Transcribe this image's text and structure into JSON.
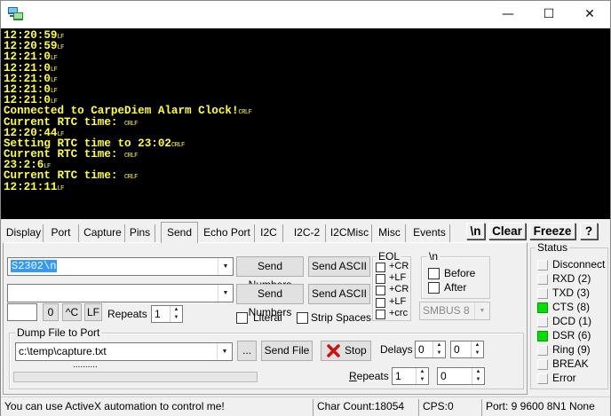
{
  "window": {
    "minimize": "—",
    "maximize": "☐",
    "close": "✕"
  },
  "terminal": {
    "lines": [
      {
        "text": "12:20:59",
        "ctrl": "LF"
      },
      {
        "text": "12:20:59",
        "ctrl": "LF"
      },
      {
        "text": "12:21:0",
        "ctrl": "LF"
      },
      {
        "text": "12:21:0",
        "ctrl": "LF"
      },
      {
        "text": "12:21:0",
        "ctrl": "LF"
      },
      {
        "text": "12:21:0",
        "ctrl": "LF"
      },
      {
        "text": "12:21:0",
        "ctrl": "LF"
      },
      {
        "text": "Connected to CarpeDiem Alarm Clock!",
        "ctrl": "CRLF"
      },
      {
        "text": "Current RTC time: ",
        "ctrl": "CRLF"
      },
      {
        "text": "12:20:44",
        "ctrl": "LF"
      },
      {
        "text": "Setting RTC time to 23:02",
        "ctrl": "CRLF"
      },
      {
        "text": "Current RTC time: ",
        "ctrl": "CRLF"
      },
      {
        "text": "23:2:6",
        "ctrl": "LF"
      },
      {
        "text": "Current RTC time: ",
        "ctrl": "CRLF"
      },
      {
        "text": "12:21:11",
        "ctrl": "LF"
      }
    ]
  },
  "tabs": [
    "Display",
    "Port",
    "Capture",
    "Pins",
    "Send",
    "Echo Port",
    "I2C",
    "I2C-2",
    "I2CMisc",
    "Misc",
    "Events"
  ],
  "toolbar": {
    "newline_toggle": "\\n",
    "clear": "Clear",
    "freeze": "Freeze",
    "help": "?"
  },
  "send": {
    "input1_value": "S2302\\n",
    "input2_value": "",
    "send_numbers": "Send Numbers",
    "send_ascii": "Send ASCII",
    "small_value": "",
    "zero_btn": "0",
    "ctrl_btn": "^C",
    "lf_btn": "LF",
    "repeats_label": "Repeats",
    "repeats_value": "1",
    "literal": "Literal",
    "strip_spaces": "Strip Spaces",
    "eol_title": "EOL",
    "eol_items": [
      "+CR",
      "+LF",
      "+CR",
      "+LF",
      "+crc"
    ],
    "nl_title": "\\n",
    "before": "Before",
    "after": "After",
    "smbus": "SMBUS 8"
  },
  "dump": {
    "title": "Dump File to Port",
    "file": "c:\\temp\\capture.txt",
    "browse": "...",
    "send_file": "Send File",
    "stop": "Stop",
    "delays_label": "Delays",
    "delay1": "0",
    "delay2": "0",
    "progress_dots": "..........",
    "repeats_label": "Repeats",
    "repeats_value": "1",
    "repeats2_value": "0"
  },
  "status": {
    "title": "Status",
    "items": [
      {
        "label": "Disconnect",
        "on": false
      },
      {
        "label": "RXD (2)",
        "on": false
      },
      {
        "label": "TXD (3)",
        "on": false
      },
      {
        "label": "CTS (8)",
        "on": true
      },
      {
        "label": "DCD (1)",
        "on": false
      },
      {
        "label": "DSR (6)",
        "on": true
      },
      {
        "label": "Ring (9)",
        "on": false
      },
      {
        "label": "BREAK",
        "on": false
      },
      {
        "label": "Error",
        "on": false
      }
    ],
    "led_on_color": "#00e000"
  },
  "statusbar": {
    "message": "You can use ActiveX automation to control me!",
    "char_count": "Char Count:18054",
    "cps": "CPS:0",
    "port": "Port: 9 9600 8N1 None"
  }
}
